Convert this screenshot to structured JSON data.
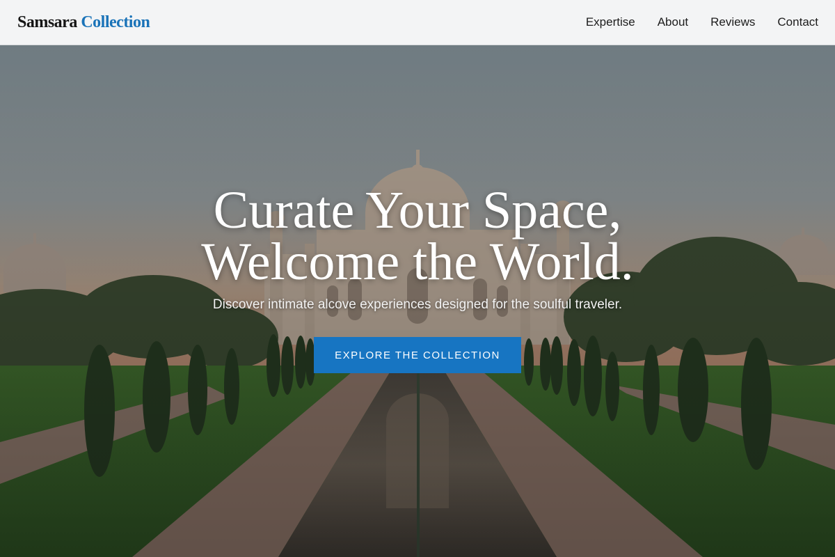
{
  "header": {
    "logo_primary": "Samsara",
    "logo_accent": "Collection",
    "nav": [
      {
        "label": "Expertise"
      },
      {
        "label": "About"
      },
      {
        "label": "Reviews"
      },
      {
        "label": "Contact"
      }
    ]
  },
  "hero": {
    "headline_line1": "Curate Your Space,",
    "headline_line2": "Welcome the World.",
    "subtitle": "Discover intimate alcove experiences designed for the soulful traveler.",
    "cta_label": "EXPLORE THE COLLECTION"
  },
  "colors": {
    "accent": "#1a73b8",
    "cta_background": "#1775c2",
    "header_background": "#f3f4f5"
  }
}
